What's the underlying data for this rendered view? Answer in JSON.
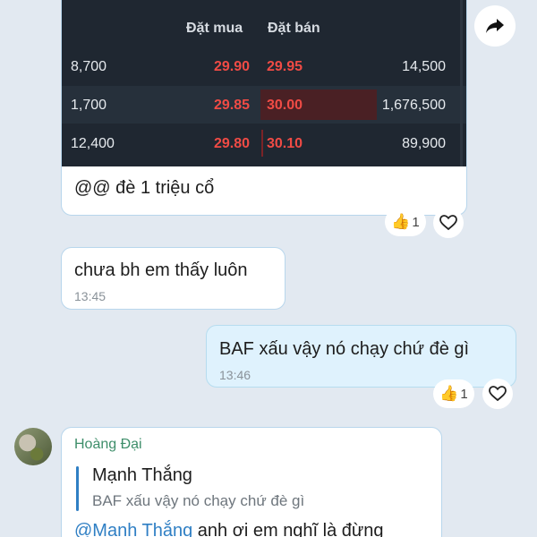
{
  "orderbook": {
    "headers": {
      "bid": "Đặt mua",
      "ask": "Đặt bán"
    },
    "rows": [
      {
        "bid_volume": "8,700",
        "bid_price": "29.90",
        "ask_price": "29.95",
        "ask_volume": "14,500"
      },
      {
        "bid_volume": "1,700",
        "bid_price": "29.85",
        "ask_price": "30.00",
        "ask_volume": "1,676,500"
      },
      {
        "bid_volume": "12,400",
        "bid_price": "29.80",
        "ask_price": "30.10",
        "ask_volume": "89,900"
      }
    ]
  },
  "messages": [
    {
      "text": "@@ đè 1 triệu cổ",
      "reaction_count": "1"
    },
    {
      "text": "chưa bh em thấy luôn",
      "time": "13:45"
    },
    {
      "text": "BAF xấu vậy nó chạy chứ đè gì",
      "time": "13:46",
      "reaction_count": "1"
    }
  ],
  "reply": {
    "sender": "Hoàng Đại",
    "quote_name": "Mạnh Thắng",
    "quote_text": "BAF xấu vậy nó chạy chứ đè gì",
    "mention": "@Mạnh Thắng",
    "text": " anh ơi em nghĩ là đừng"
  },
  "colors": {
    "bid_ask_price": "#f04b45",
    "sender_name": "#3e8e6a",
    "quote_bar": "#2f7fc4",
    "own_bubble": "#dff2fd"
  },
  "icons": [
    "share-icon",
    "thumbs-up-icon",
    "heart-outline-icon"
  ]
}
